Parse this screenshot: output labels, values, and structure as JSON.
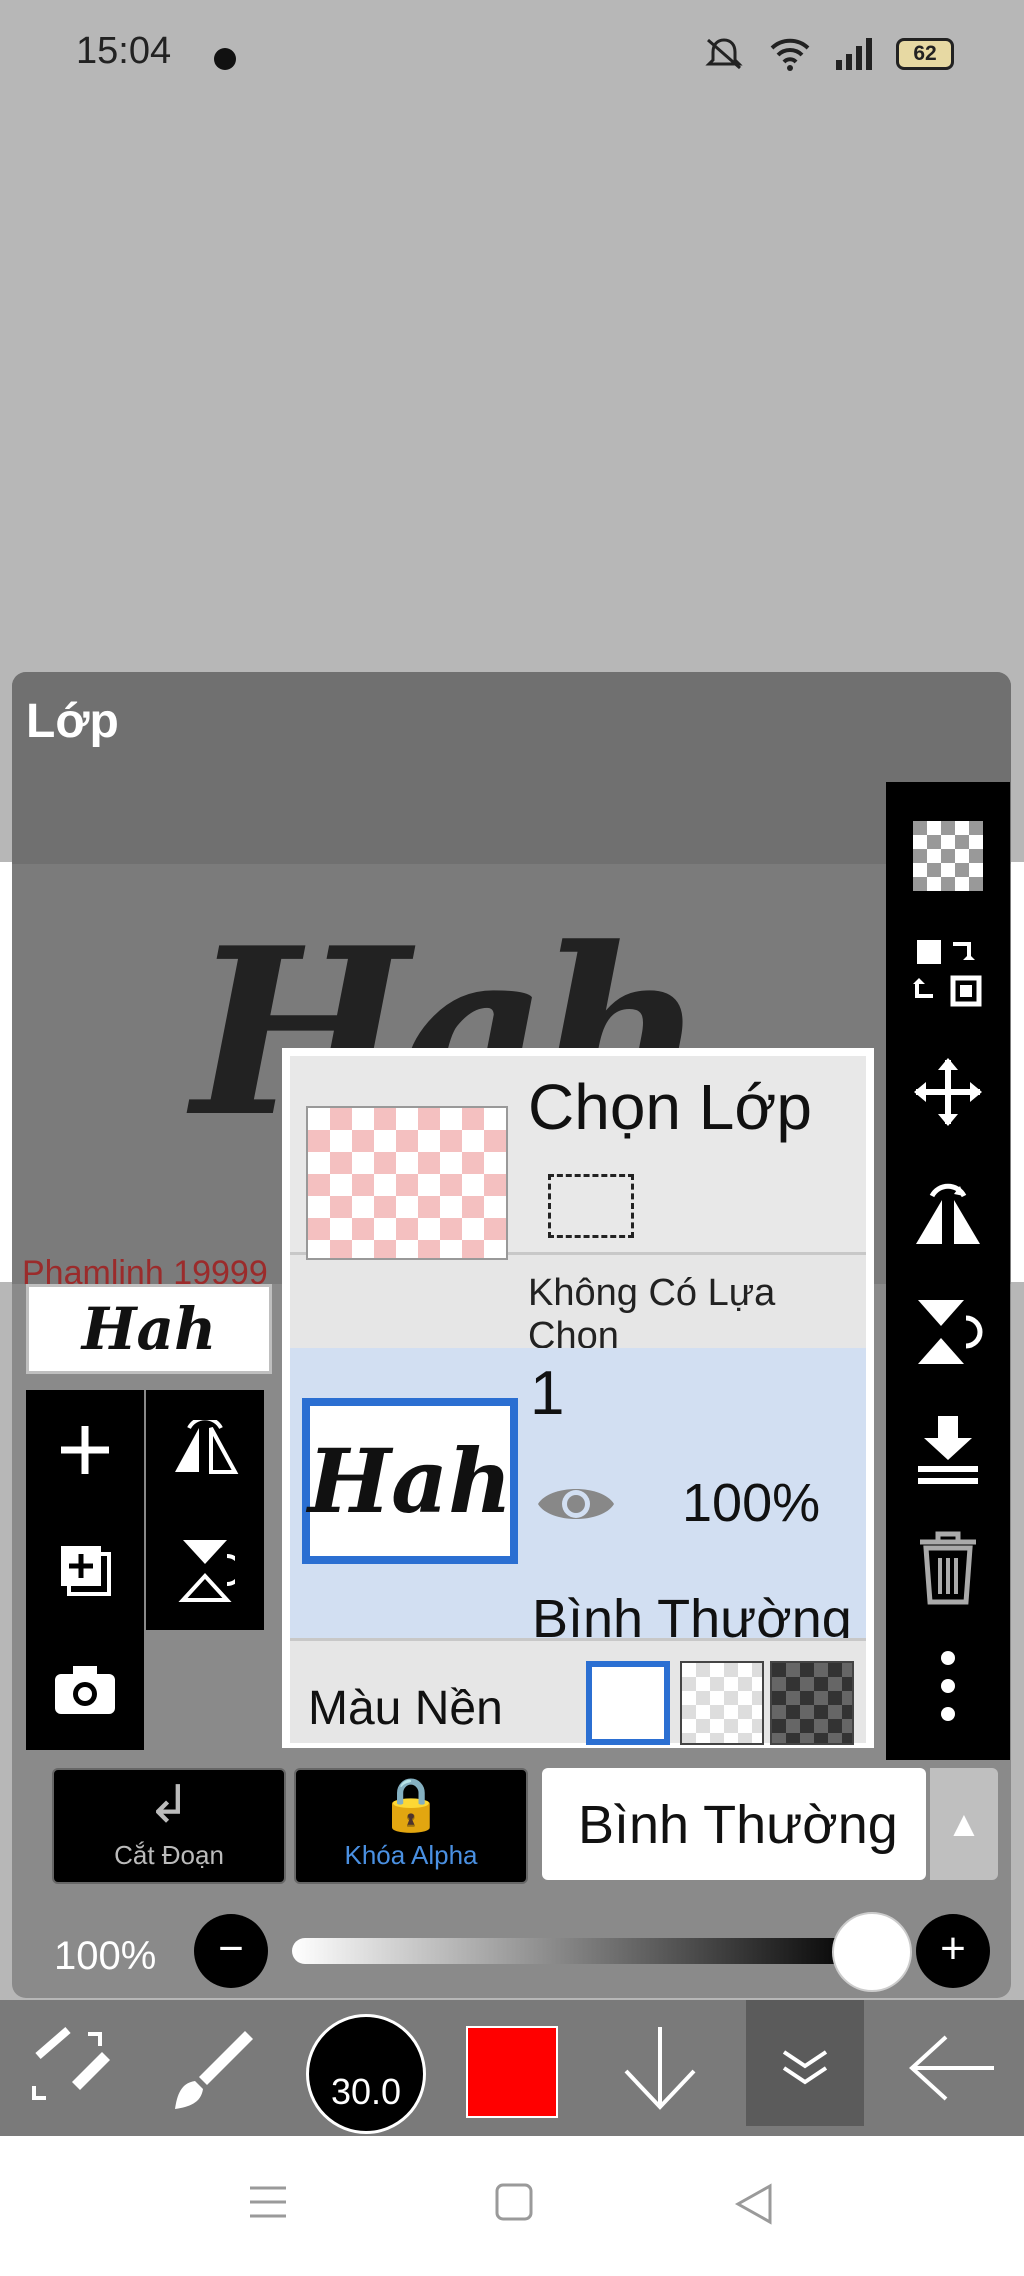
{
  "status": {
    "time": "15:04",
    "battery": "62"
  },
  "panel": {
    "title": "Lớp"
  },
  "canvas": {
    "art_text": "Hah",
    "signature": "Phamlinh 19999"
  },
  "layer_thumb": {
    "art_text": "Hah"
  },
  "layer_popup": {
    "select_layer_title": "Chọn Lớp",
    "no_selection": "Không Có Lựa Chọn",
    "layer_number": "1",
    "layer_art_text": "Hah",
    "opacity": "100%",
    "blend_mode": "Bình Thường",
    "bg_color_label": "Màu Nền"
  },
  "controls": {
    "clip_label": "Cắt Đoạn",
    "alpha_lock_label": "Khóa Alpha",
    "blend_select_label": "Bình Thường",
    "opacity_label": "100%",
    "opacity_fraction": 1.0
  },
  "toolbar": {
    "brush_size": "30.0",
    "color": "#ff0000"
  },
  "icons": [
    "transparency-icon",
    "layer-swap-icon",
    "move-icon",
    "flip-horizontal-icon",
    "flip-vertical-icon",
    "merge-down-icon",
    "trash-icon",
    "more-vert-icon"
  ]
}
